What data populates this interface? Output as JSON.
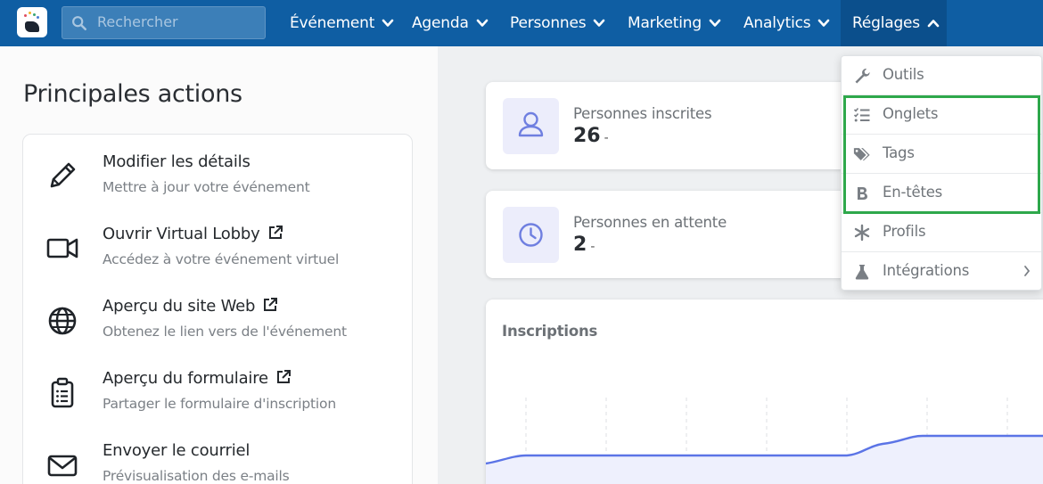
{
  "colors": {
    "topbar": "#0f5ea3",
    "accent_chart": "#5b74e6",
    "highlight": "#2ea84b"
  },
  "search": {
    "placeholder": "Rechercher",
    "icon": "search-icon"
  },
  "nav": {
    "items": [
      {
        "label": "Événement"
      },
      {
        "label": "Agenda"
      },
      {
        "label": "Personnes"
      },
      {
        "label": "Marketing"
      },
      {
        "label": "Analytics"
      },
      {
        "label": "Réglages",
        "active": true
      }
    ]
  },
  "left": {
    "heading": "Principales actions",
    "actions": [
      {
        "title": "Modifier les détails",
        "subtitle": "Mettre à jour votre événement",
        "icon": "pencil-icon"
      },
      {
        "title": "Ouvrir Virtual Lobby",
        "subtitle": "Accédez à votre événement virtuel",
        "icon": "video-camera-icon",
        "external": true
      },
      {
        "title": "Aperçu du site Web",
        "subtitle": "Obtenez le lien vers de l'événement",
        "icon": "globe-icon",
        "external": true
      },
      {
        "title": "Aperçu du formulaire",
        "subtitle": "Partager le formulaire d'inscription",
        "icon": "clipboard-icon",
        "external": true
      },
      {
        "title": "Envoyer le courriel",
        "subtitle": "Prévisualisation des e-mails",
        "icon": "envelope-icon"
      }
    ]
  },
  "stats": [
    {
      "label": "Personnes inscrites",
      "value": "26",
      "suffix": "-",
      "icon": "user-icon"
    },
    {
      "label": "Personnes en attente",
      "value": "2",
      "suffix": "-",
      "icon": "clock-icon"
    }
  ],
  "chart": {
    "title": "Inscriptions"
  },
  "dropdown": {
    "items": [
      {
        "label": "Outils",
        "icon": "wrench-icon"
      },
      {
        "label": "Onglets",
        "icon": "list-check-icon"
      },
      {
        "label": "Tags",
        "icon": "tags-icon"
      },
      {
        "label": "En-têtes",
        "icon": "bold-icon"
      },
      {
        "label": "Profils",
        "icon": "asterisk-icon"
      },
      {
        "label": "Intégrations",
        "icon": "flask-icon",
        "submenu": true
      }
    ]
  }
}
